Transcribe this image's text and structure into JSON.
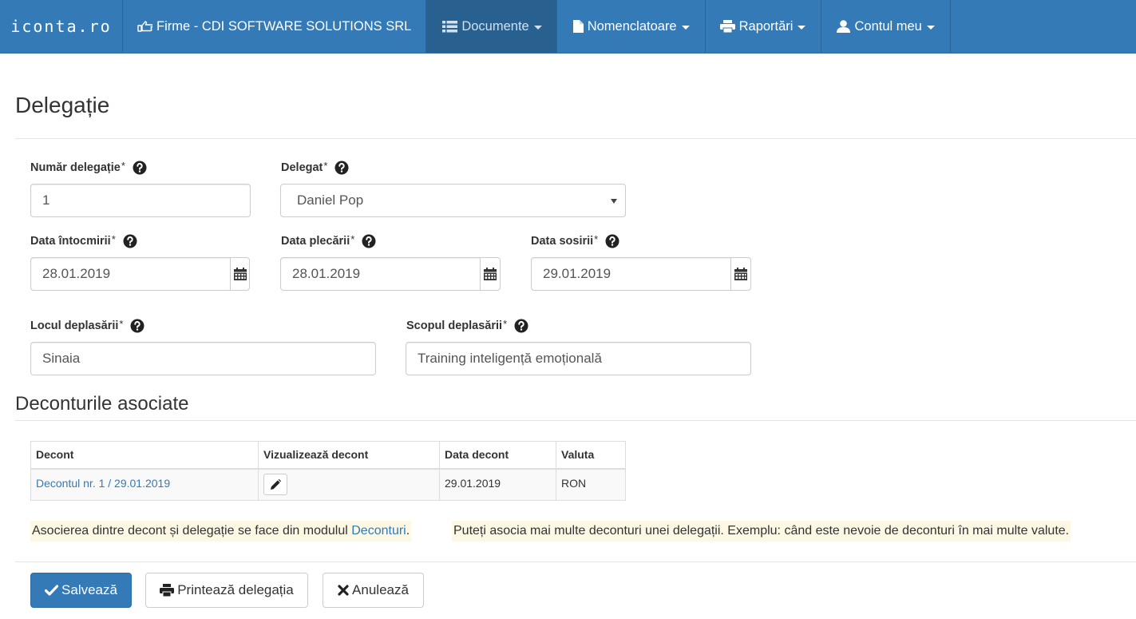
{
  "navbar": {
    "brand": "iconta.ro",
    "items": [
      {
        "label": "Firme - CDI SOFTWARE SOLUTIONS SRL",
        "icon": "hand-pointing-icon"
      },
      {
        "label": "Documente",
        "icon": "list-icon"
      },
      {
        "label": "Nomenclatoare",
        "icon": "file-icon"
      },
      {
        "label": "Raportări",
        "icon": "printer-icon"
      },
      {
        "label": "Contul meu",
        "icon": "user-icon"
      }
    ]
  },
  "page": {
    "title": "Delegație"
  },
  "form": {
    "numar_label": "Număr delegație",
    "numar_value": "1",
    "delegat_label": "Delegat",
    "delegat_value": "Daniel Pop",
    "data_intocmirii_label": "Data întocmirii",
    "data_intocmirii_value": "28.01.2019",
    "data_plecarii_label": "Data plecării",
    "data_plecarii_value": "28.01.2019",
    "data_sosirii_label": "Data sosirii",
    "data_sosirii_value": "29.01.2019",
    "locul_label": "Locul deplasării",
    "locul_value": "Sinaia",
    "scopul_label": "Scopul deplasării",
    "scopul_value": "Training inteligență emoțională",
    "required_mark": "*"
  },
  "deconturi": {
    "title": "Deconturile asociate",
    "columns": [
      "Decont",
      "Vizualizează decont",
      "Data decont",
      "Valuta"
    ],
    "rows": [
      {
        "decont": "Decontul nr. 1 / 29.01.2019",
        "data": "29.01.2019",
        "valuta": "RON"
      }
    ]
  },
  "note": {
    "part1_before": "Asocierea dintre decont și delegație se face din modulul ",
    "part1_link": "Deconturi",
    "part1_after": ".",
    "part2": "Puteți asocia mai multe deconturi unei delegații. Exemplu: când este nevoie de deconturi în mai multe valute."
  },
  "actions": {
    "save": "Salvează",
    "print": "Printează delegația",
    "cancel": "Anulează"
  },
  "colors": {
    "primary": "#337ab7",
    "navbar_active": "#286090",
    "note_bg": "#fcf8e3",
    "link": "#337ab7"
  }
}
